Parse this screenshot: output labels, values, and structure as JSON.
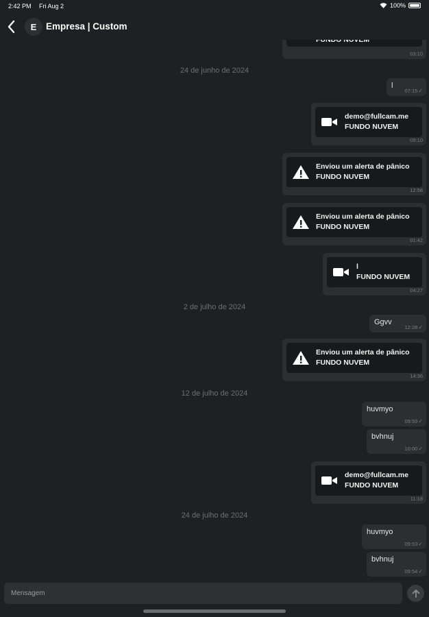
{
  "status": {
    "time": "2:42 PM",
    "date": "Fri Aug 2",
    "battery": "100%"
  },
  "header": {
    "avatar_letter": "E",
    "title": "Empresa | Custom"
  },
  "dates": {
    "d1": "24 de junho de 2024",
    "d2": "2 de julho de 2024",
    "d3": "12 de julho de 2024",
    "d4": "24 de julho de 2024"
  },
  "messages": {
    "m0": {
      "line2": "FUNDO NUVEM",
      "time": "03:10"
    },
    "m1": {
      "text": "l",
      "time": "07:15"
    },
    "m2": {
      "line1": "demo@fullcam.me",
      "line2": "FUNDO NUVEM",
      "time": "09:10",
      "icon": "video-camera-icon"
    },
    "m3": {
      "line1": "Enviou um alerta de pânico",
      "line2": "FUNDO NUVEM",
      "time": "12:58",
      "icon": "warning-icon"
    },
    "m4": {
      "line1": "Enviou um alerta de pânico",
      "line2": "FUNDO NUVEM",
      "time": "01:42",
      "icon": "warning-icon"
    },
    "m5": {
      "line1": "l",
      "line2": "FUNDO NUVEM",
      "time": "04:27",
      "icon": "video-camera-icon"
    },
    "m6": {
      "text": "Ggvv",
      "time": "12:28"
    },
    "m7": {
      "line1": "Enviou um alerta de pânico",
      "line2": "FUNDO NUVEM",
      "time": "14:36",
      "icon": "warning-icon"
    },
    "m8": {
      "text": "huvmyo",
      "time": "09:59"
    },
    "m9": {
      "text": "bvhnuj",
      "time": "10:00"
    },
    "m10": {
      "line1": "demo@fullcam.me",
      "line2": "FUNDO NUVEM",
      "time": "11:18",
      "icon": "video-camera-icon"
    },
    "m11": {
      "text": "huvmyo",
      "time": "09:53"
    },
    "m12": {
      "text": "bvhnuj",
      "time": "09:54"
    }
  },
  "composer": {
    "placeholder": "Mensagem"
  },
  "colors": {
    "background": "#1f2023",
    "bubble": "#2d2e32",
    "card": "#18191c",
    "meta": "#7c7d80"
  }
}
